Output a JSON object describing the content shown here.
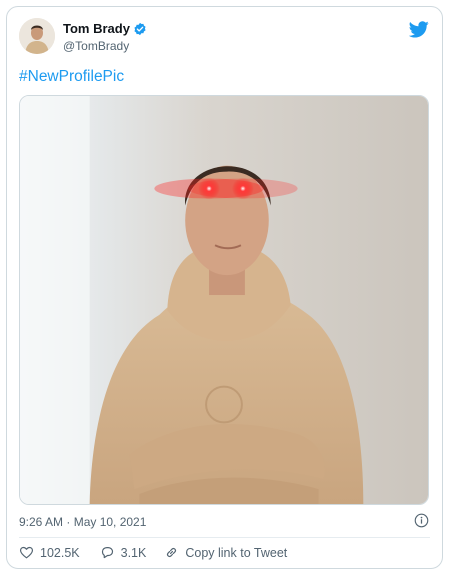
{
  "tweet": {
    "author_name": "Tom Brady",
    "author_handle": "@TomBrady",
    "verified": true,
    "text": "#NewProfilePic",
    "timestamp": "9:26 AM · May 10, 2021",
    "likes": "102.5K",
    "replies": "3.1K",
    "copy_link_label": "Copy link to Tweet"
  },
  "icons": {
    "brand": "twitter-bird-icon",
    "verified": "verified-badge-icon",
    "info": "info-icon",
    "like": "heart-icon",
    "reply": "reply-bubble-icon",
    "link": "link-icon"
  },
  "colors": {
    "accent": "#1d9bf0",
    "text": "#0f1419",
    "secondary": "#536471",
    "border": "#cfd9de",
    "laser": "#ff1a1a"
  }
}
